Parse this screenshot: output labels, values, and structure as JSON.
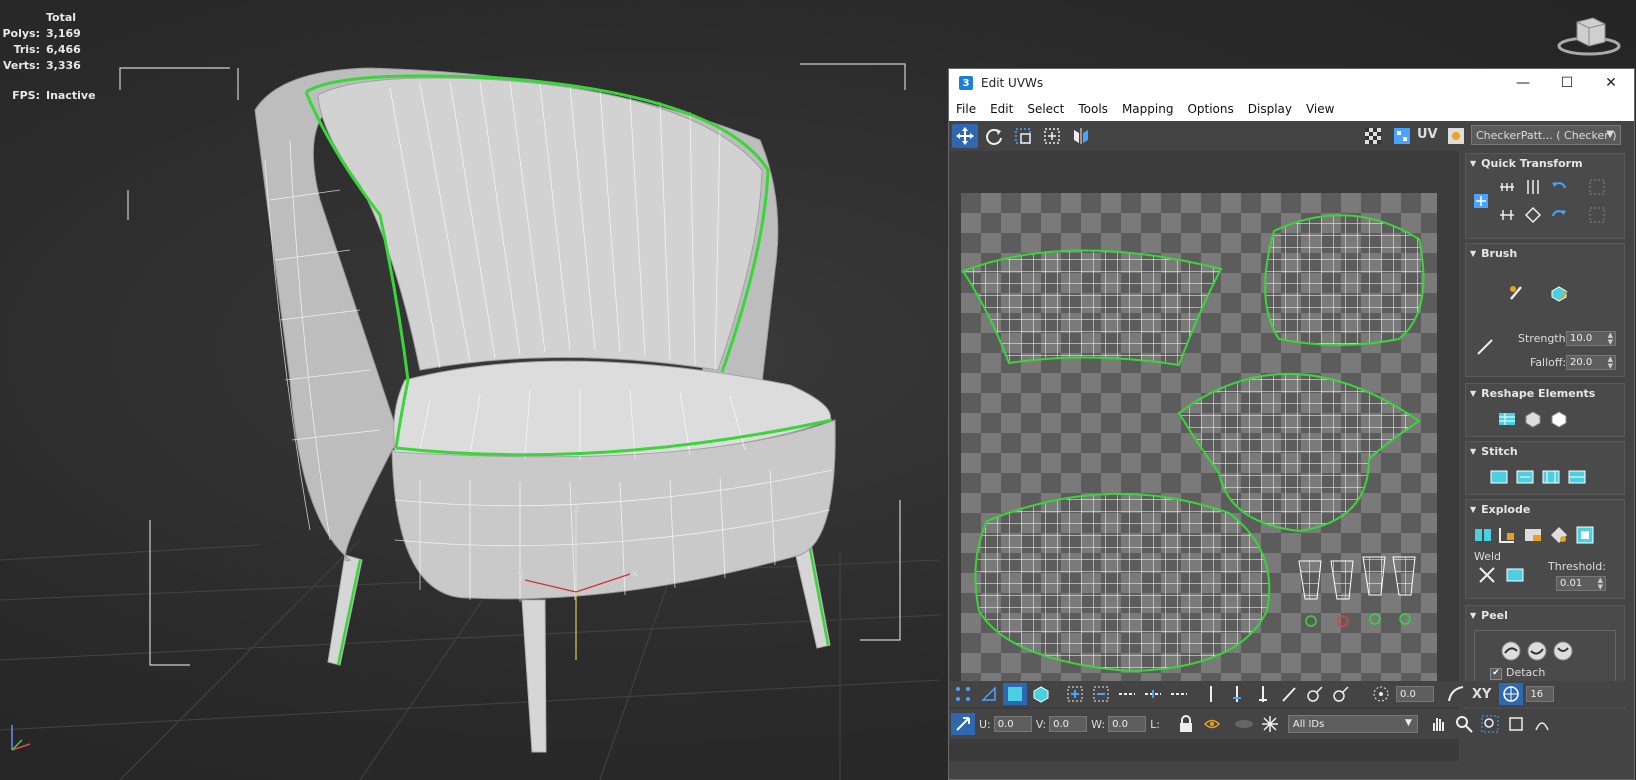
{
  "stats": {
    "header": "Total",
    "rows": [
      {
        "label": "Polys:",
        "value": "3,169"
      },
      {
        "label": "Tris:",
        "value": "6,466"
      },
      {
        "label": "Verts:",
        "value": "3,336"
      }
    ],
    "fps_label": "FPS:",
    "fps_value": "Inactive"
  },
  "viewport": {
    "axis_z": "z",
    "axis_y": "y",
    "axis_x": "x"
  },
  "window": {
    "app_icon": "3",
    "title": "Edit UVWs",
    "minimize": "—",
    "maximize": "☐",
    "close": "✕"
  },
  "menu": [
    "File",
    "Edit",
    "Select",
    "Tools",
    "Mapping",
    "Options",
    "Display",
    "View"
  ],
  "toolbar": {
    "uv_label": "UV",
    "texture_dropdown": "CheckerPatt... ( Checker )"
  },
  "panel": {
    "quick_transform": "Quick Transform",
    "brush": "Brush",
    "strength_label": "Strength:",
    "strength_value": "10.0",
    "falloff_label": "Falloff:",
    "falloff_value": "20.0",
    "reshape": "Reshape Elements",
    "stitch": "Stitch",
    "explode": "Explode",
    "weld_label": "Weld",
    "threshold_label": "Threshold:",
    "threshold_value": "0.01",
    "peel": "Peel",
    "detach_label": "Detach",
    "detach_checked": true
  },
  "bottom": {
    "rotate_value": "0.0",
    "axis_label": "XY",
    "grid_value": "16",
    "u_label": "U:",
    "u_value": "0.0",
    "v_label": "V:",
    "v_value": "0.0",
    "w_label": "W:",
    "w_value": "0.0",
    "l_label": "L:",
    "ids_dropdown": "All IDs"
  },
  "colors": {
    "seam_green": "#39d639",
    "active_blue": "#2f68b0",
    "window_bg": "#444444"
  }
}
